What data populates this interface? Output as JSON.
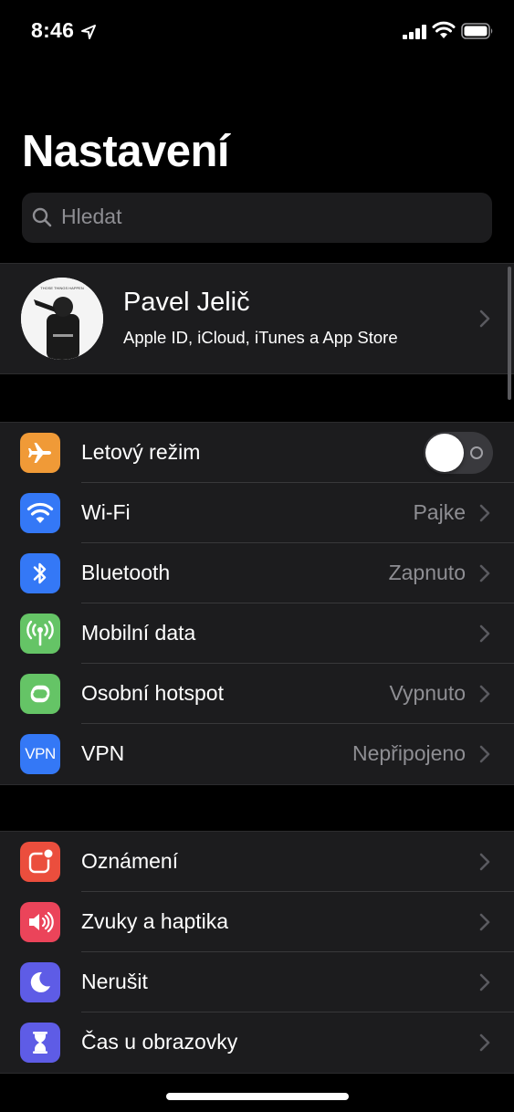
{
  "status_bar": {
    "time": "8:46",
    "location_icon": "location-arrow-icon",
    "signal_icon": "cellular-signal-icon",
    "wifi_icon": "wifi-icon",
    "battery_icon": "battery-icon"
  },
  "header": {
    "title": "Nastavení"
  },
  "search": {
    "placeholder": "Hledat",
    "icon": "search-icon"
  },
  "profile": {
    "name": "Pavel Jelič",
    "subtitle": "Apple ID, iCloud, iTunes a App Store"
  },
  "connectivity_group": [
    {
      "label": "Letový režim",
      "value": "",
      "icon": "airplane-icon",
      "color": "#f09a37",
      "toggle": false
    },
    {
      "label": "Wi-Fi",
      "value": "Pajke",
      "icon": "wifi-icon",
      "color": "#3478f6"
    },
    {
      "label": "Bluetooth",
      "value": "Zapnuto",
      "icon": "bluetooth-icon",
      "color": "#3478f6"
    },
    {
      "label": "Mobilní data",
      "value": "",
      "icon": "antenna-icon",
      "color": "#65c466"
    },
    {
      "label": "Osobní hotspot",
      "value": "Vypnuto",
      "icon": "hotspot-icon",
      "color": "#65c466"
    },
    {
      "label": "VPN",
      "value": "Nepřipojeno",
      "icon": "vpn-icon",
      "icon_text": "VPN",
      "color": "#3478f6"
    }
  ],
  "notifications_group": [
    {
      "label": "Oznámení",
      "value": "",
      "icon": "notifications-icon",
      "color": "#eb4e3d"
    },
    {
      "label": "Zvuky a haptika",
      "value": "",
      "icon": "speaker-icon",
      "color": "#eb445a"
    },
    {
      "label": "Nerušit",
      "value": "",
      "icon": "moon-icon",
      "color": "#5e5ce6"
    },
    {
      "label": "Čas u obrazovky",
      "value": "",
      "icon": "hourglass-icon",
      "color": "#5e5ce6"
    }
  ]
}
